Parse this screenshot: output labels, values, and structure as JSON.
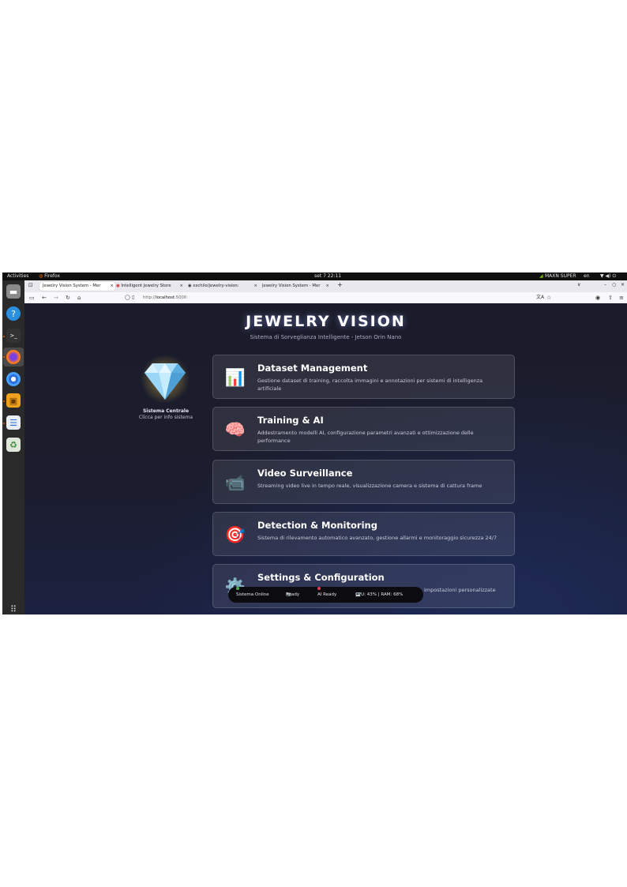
{
  "topbar": {
    "activities": "Activities",
    "app": "Firefox",
    "clock": "set 7  22:11",
    "nvidia_label": "MAXN SUPER",
    "language": "en"
  },
  "dock": {
    "items": [
      "files",
      "help",
      "terminal",
      "firefox",
      "chromium",
      "archive",
      "text-editor",
      "recycle"
    ]
  },
  "browser": {
    "tabs": [
      {
        "label": "Jewelry Vision System - Mer"
      },
      {
        "label": "Intelligent Jewelry Store"
      },
      {
        "label": "eschilo/jewelry-vision: "
      },
      {
        "label": "Jewelry Vision System - Mer"
      }
    ],
    "url_prefix": "http://",
    "url_host": "localhost",
    "url_suffix": ":5000"
  },
  "page": {
    "title": "JEWELRY VISION",
    "subtitle": "Sistema di Sorveglianza Intelligente - Jetson Orin Nano",
    "central": {
      "label": "Sistema Centrale",
      "sub": "Clicca per info sistema"
    },
    "cards": [
      {
        "icon": "📊",
        "title": "Dataset Management",
        "desc": "Gestione dataset di training, raccolta immagini e annotazioni per sistemi di intelligenza artificiale"
      },
      {
        "icon": "🧠",
        "title": "Training & AI",
        "desc": "Addestramento modelli AI, configurazione parametri avanzati e ottimizzazione delle performance"
      },
      {
        "icon": "📹",
        "title": "Video Surveillance",
        "desc": "Streaming video live in tempo reale, visualizzazione camera e sistema di cattura frame"
      },
      {
        "icon": "🎯",
        "title": "Detection & Monitoring",
        "desc": "Sistema di rilevamento automatico avanzato, gestione allarmi e monitoraggio sicurezza 24/7"
      },
      {
        "icon": "⚙️",
        "title": "Settings & Configuration",
        "desc": "impostazioni personalizzate"
      }
    ],
    "status": {
      "online": "Sistema Online",
      "camera": "Ready",
      "ai": "AI Ready",
      "resources": "CPU: 43% | RAM: 68%"
    }
  },
  "colors": {
    "online_dot": "#4caf50",
    "ai_dot": "#e53950",
    "accent": "#76b900"
  }
}
